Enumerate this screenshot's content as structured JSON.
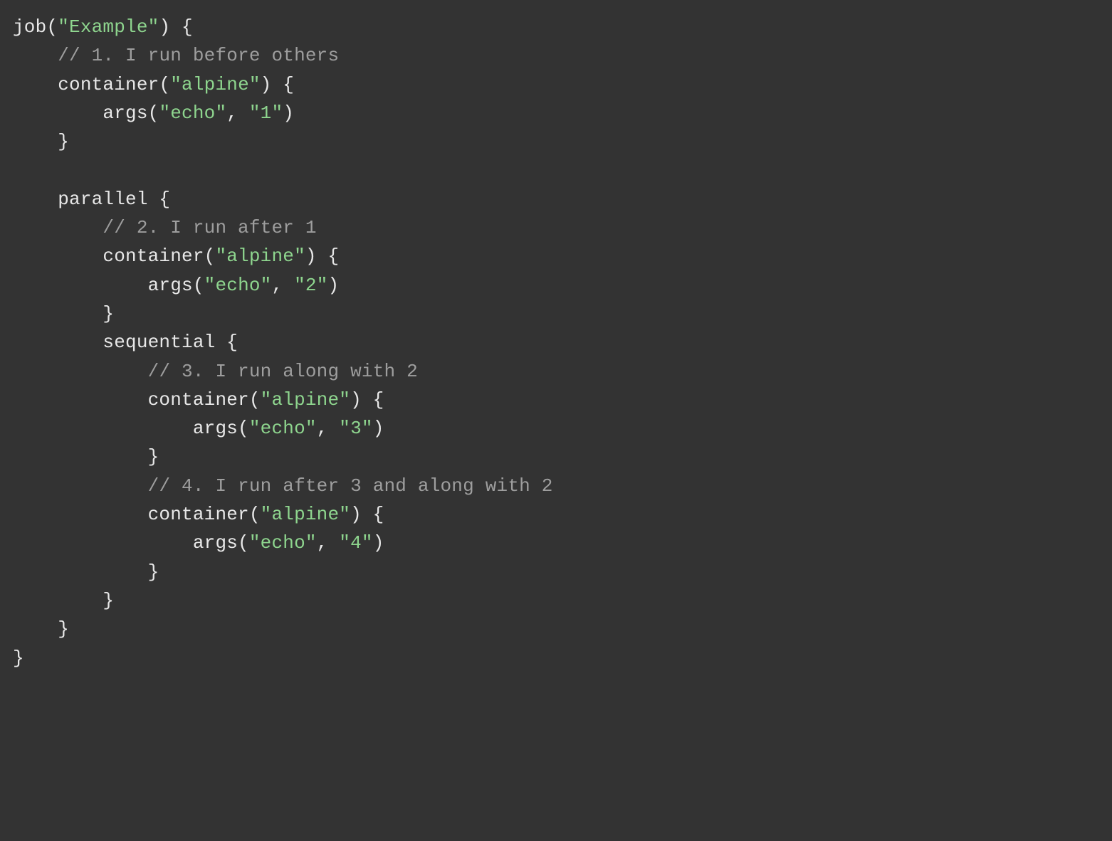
{
  "code": {
    "lines": [
      [
        {
          "cls": "plain",
          "txt": "job("
        },
        {
          "cls": "str",
          "txt": "\"Example\""
        },
        {
          "cls": "plain",
          "txt": ") {"
        }
      ],
      [
        {
          "cls": "plain",
          "txt": "    "
        },
        {
          "cls": "cmt",
          "txt": "// 1. I run before others"
        }
      ],
      [
        {
          "cls": "plain",
          "txt": "    container("
        },
        {
          "cls": "str",
          "txt": "\"alpine\""
        },
        {
          "cls": "plain",
          "txt": ") {"
        }
      ],
      [
        {
          "cls": "plain",
          "txt": "        args("
        },
        {
          "cls": "str",
          "txt": "\"echo\""
        },
        {
          "cls": "plain",
          "txt": ", "
        },
        {
          "cls": "str",
          "txt": "\"1\""
        },
        {
          "cls": "plain",
          "txt": ")"
        }
      ],
      [
        {
          "cls": "plain",
          "txt": "    }"
        }
      ],
      [
        {
          "cls": "plain",
          "txt": ""
        }
      ],
      [
        {
          "cls": "plain",
          "txt": "    parallel {"
        }
      ],
      [
        {
          "cls": "plain",
          "txt": "        "
        },
        {
          "cls": "cmt",
          "txt": "// 2. I run after 1"
        }
      ],
      [
        {
          "cls": "plain",
          "txt": "        container("
        },
        {
          "cls": "str",
          "txt": "\"alpine\""
        },
        {
          "cls": "plain",
          "txt": ") {"
        }
      ],
      [
        {
          "cls": "plain",
          "txt": "            args("
        },
        {
          "cls": "str",
          "txt": "\"echo\""
        },
        {
          "cls": "plain",
          "txt": ", "
        },
        {
          "cls": "str",
          "txt": "\"2\""
        },
        {
          "cls": "plain",
          "txt": ")"
        }
      ],
      [
        {
          "cls": "plain",
          "txt": "        }"
        }
      ],
      [
        {
          "cls": "plain",
          "txt": "        sequential {"
        }
      ],
      [
        {
          "cls": "plain",
          "txt": "            "
        },
        {
          "cls": "cmt",
          "txt": "// 3. I run along with 2"
        }
      ],
      [
        {
          "cls": "plain",
          "txt": "            container("
        },
        {
          "cls": "str",
          "txt": "\"alpine\""
        },
        {
          "cls": "plain",
          "txt": ") {"
        }
      ],
      [
        {
          "cls": "plain",
          "txt": "                args("
        },
        {
          "cls": "str",
          "txt": "\"echo\""
        },
        {
          "cls": "plain",
          "txt": ", "
        },
        {
          "cls": "str",
          "txt": "\"3\""
        },
        {
          "cls": "plain",
          "txt": ")"
        }
      ],
      [
        {
          "cls": "plain",
          "txt": "            }"
        }
      ],
      [
        {
          "cls": "plain",
          "txt": "            "
        },
        {
          "cls": "cmt",
          "txt": "// 4. I run after 3 and along with 2"
        }
      ],
      [
        {
          "cls": "plain",
          "txt": "            container("
        },
        {
          "cls": "str",
          "txt": "\"alpine\""
        },
        {
          "cls": "plain",
          "txt": ") {"
        }
      ],
      [
        {
          "cls": "plain",
          "txt": "                args("
        },
        {
          "cls": "str",
          "txt": "\"echo\""
        },
        {
          "cls": "plain",
          "txt": ", "
        },
        {
          "cls": "str",
          "txt": "\"4\""
        },
        {
          "cls": "plain",
          "txt": ")"
        }
      ],
      [
        {
          "cls": "plain",
          "txt": "            }"
        }
      ],
      [
        {
          "cls": "plain",
          "txt": "        }"
        }
      ],
      [
        {
          "cls": "plain",
          "txt": "    }"
        }
      ],
      [
        {
          "cls": "plain",
          "txt": "}"
        }
      ]
    ]
  }
}
